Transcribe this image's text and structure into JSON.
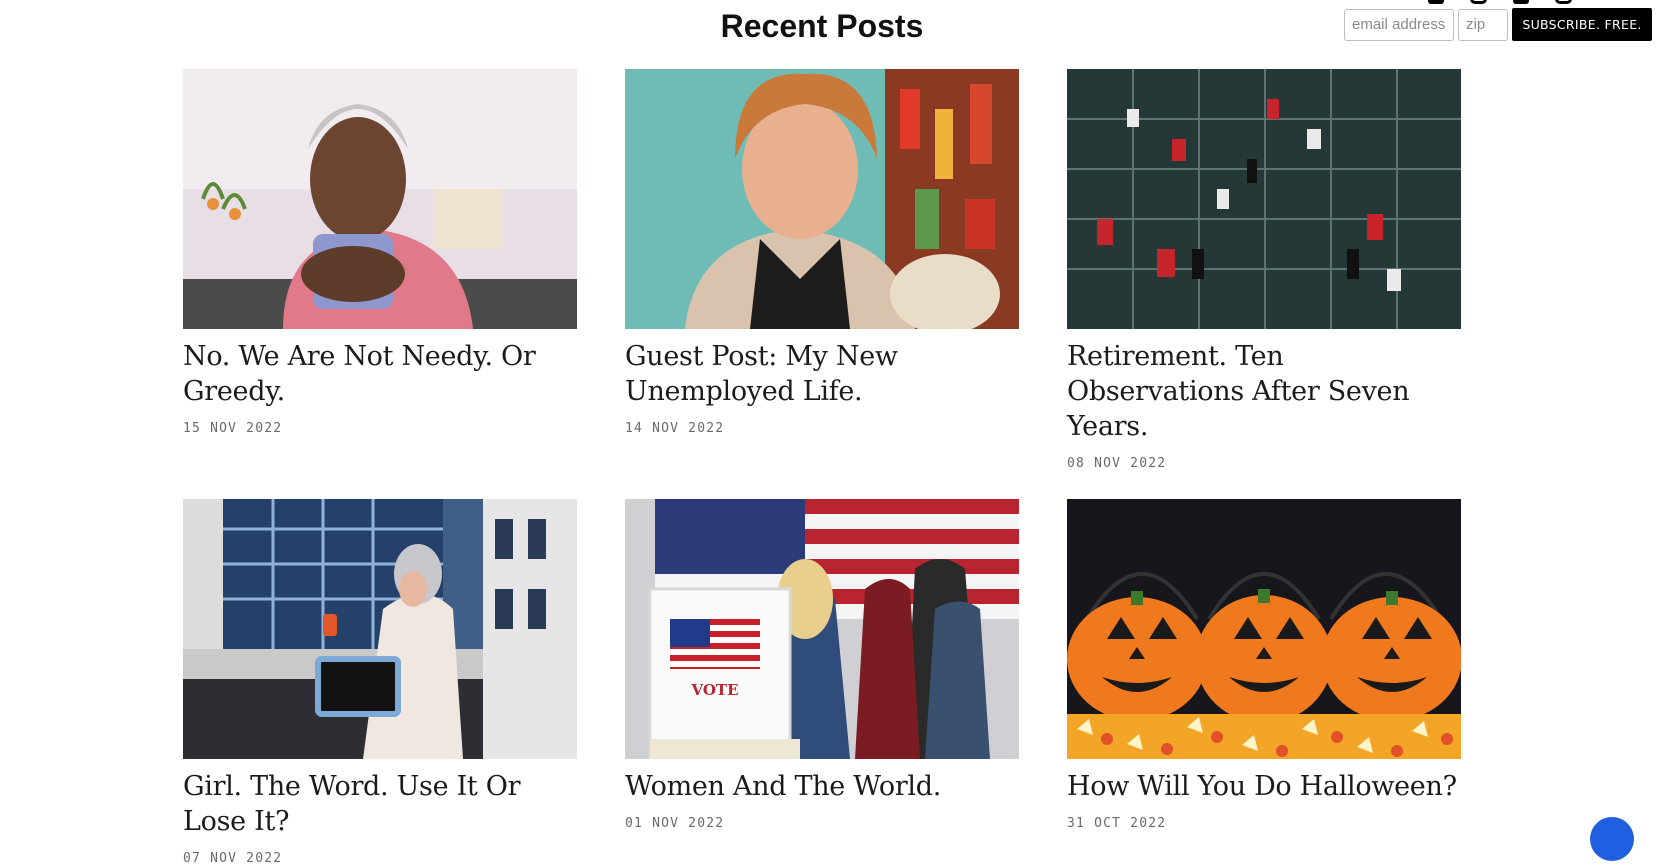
{
  "header": {
    "section_title": "Recent Posts",
    "subscribe": {
      "email_placeholder": "email address",
      "zip_placeholder": "zip",
      "button_label": "SUBSCRIBE. FREE."
    }
  },
  "posts": [
    {
      "title": "No. We Are Not Needy. Or Greedy.",
      "date": "15 NOV 2022"
    },
    {
      "title": "Guest Post: My New Unemployed Life.",
      "date": "14 NOV 2022"
    },
    {
      "title": "Retirement. Ten Observations After Seven Years.",
      "date": "08 NOV 2022"
    },
    {
      "title": "Girl. The Word. Use It Or Lose It?",
      "date": "07 NOV 2022"
    },
    {
      "title": "Women And The World.",
      "date": "01 NOV 2022"
    },
    {
      "title": "How Will You Do Halloween?",
      "date": "31 OCT 2022"
    }
  ],
  "images": {
    "post_5_sign_text": "VOTE"
  },
  "colors": {
    "subscribe_button": "#000000",
    "chat_launcher": "#1f5fe0"
  }
}
